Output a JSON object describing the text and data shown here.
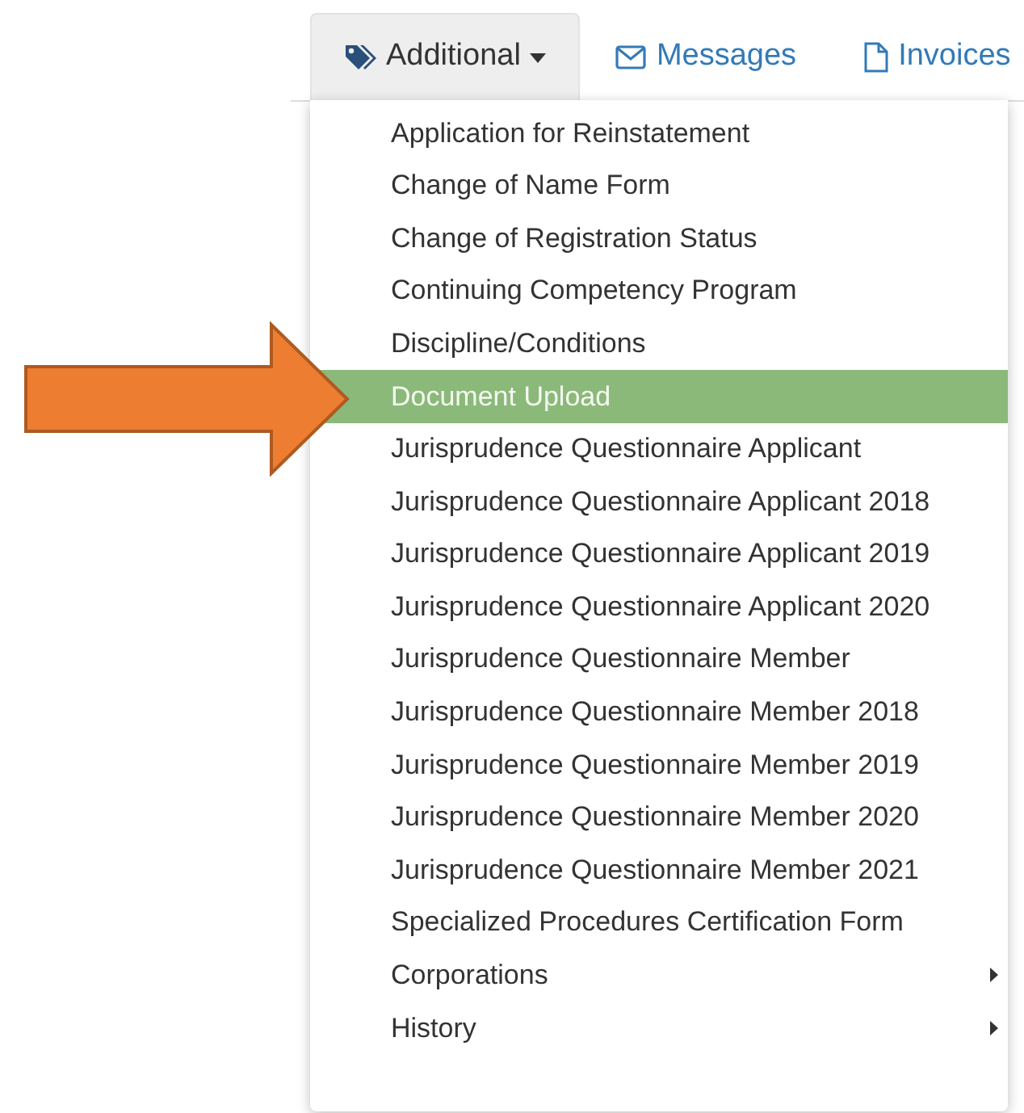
{
  "tabs": [
    {
      "label": "Additional",
      "selected": true,
      "kind": "dropdown"
    },
    {
      "label": "Messages",
      "selected": false,
      "kind": "messages"
    },
    {
      "label": "Invoices",
      "selected": false,
      "kind": "invoices"
    }
  ],
  "menu": {
    "items": [
      {
        "label": "Application for Reinstatement",
        "selected": false,
        "submenu": false
      },
      {
        "label": "Change of Name Form",
        "selected": false,
        "submenu": false
      },
      {
        "label": "Change of Registration Status",
        "selected": false,
        "submenu": false
      },
      {
        "label": "Continuing Competency Program",
        "selected": false,
        "submenu": false
      },
      {
        "label": "Discipline/Conditions",
        "selected": false,
        "submenu": false
      },
      {
        "label": "Document Upload",
        "selected": true,
        "submenu": false
      },
      {
        "label": "Jurisprudence Questionnaire Applicant",
        "selected": false,
        "submenu": false
      },
      {
        "label": "Jurisprudence Questionnaire Applicant 2018",
        "selected": false,
        "submenu": false
      },
      {
        "label": "Jurisprudence Questionnaire Applicant 2019",
        "selected": false,
        "submenu": false
      },
      {
        "label": "Jurisprudence Questionnaire Applicant 2020",
        "selected": false,
        "submenu": false
      },
      {
        "label": "Jurisprudence Questionnaire Member",
        "selected": false,
        "submenu": false
      },
      {
        "label": "Jurisprudence Questionnaire Member 2018",
        "selected": false,
        "submenu": false
      },
      {
        "label": "Jurisprudence Questionnaire Member 2019",
        "selected": false,
        "submenu": false
      },
      {
        "label": "Jurisprudence Questionnaire Member 2020",
        "selected": false,
        "submenu": false
      },
      {
        "label": "Jurisprudence Questionnaire Member 2021",
        "selected": false,
        "submenu": false
      },
      {
        "label": "Specialized Procedures Certification Form",
        "selected": false,
        "submenu": false
      },
      {
        "label": "Corporations",
        "selected": false,
        "submenu": true
      },
      {
        "label": "History",
        "selected": false,
        "submenu": true
      }
    ]
  }
}
